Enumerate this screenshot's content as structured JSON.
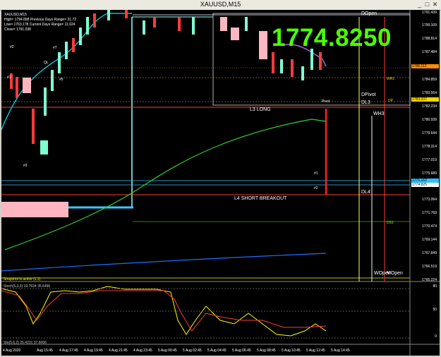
{
  "window": {
    "title": "XAUUSD,M15"
  },
  "info_panel": {
    "symbol": "XAUUSD,M15",
    "high": "High= 1794.898",
    "low": "Low= 1763.178",
    "close": "Close= 1791.038",
    "prev_range": "Previous Days Range= 31.72",
    "curr_range": "Current Days Range= 11.624"
  },
  "current_price_display": "1774.8250",
  "levels": {
    "dopen": "DOpen",
    "dpivot": "DPivot",
    "dl3": "DL3",
    "dp": "DP",
    "wh3": "WH3",
    "wr1": "WR1",
    "dl4": "DL4",
    "ds1": "DS1",
    "wopen": "WOpen",
    "mopen": "MOpen",
    "pivot": "Pivot",
    "l3_long": "L3 LONG",
    "l4_short": "L4 SHORT BREAKOUT",
    "s1": "#1",
    "s2": "#2",
    "s3": "#3",
    "s4": "#4",
    "s5": "#5",
    "s7": "#7",
    "ql": "QL",
    "one_marker": "1"
  },
  "snapshot_text": "Snapshot is active (1,1)",
  "indicator": {
    "stoch_label": "Stoch(5,3,3) 19.7634 35.6496",
    "stoch2_label": "Sto(5,6,2) 25.4231 37.6006",
    "levels": [
      "80",
      "50",
      "0"
    ]
  },
  "price_axis": [
    "1791.439",
    "1790.109",
    "1788.814",
    "1787.484",
    "1786.112",
    "1784.859",
    "1783.564",
    "1782.234",
    "1780.939",
    "1779.644",
    "1778.314",
    "1777.019",
    "1775.689",
    "1774.394",
    "1773.064",
    "1771.769",
    "1770.474",
    "1769.144",
    "1767.849",
    "1766.519",
    "1765.224"
  ],
  "price_tags": {
    "top": "1786.112",
    "mid": "1783.037",
    "b1": "1775.162",
    "b2": "1774.825"
  },
  "time_axis": [
    "4 Aug 2020",
    "Aug 15:45",
    "4 Aug 17:45",
    "4 Aug 19:45",
    "4 Aug 21:45",
    "4 Aug 23:45",
    "5 Aug 00:45",
    "5 Aug 02:45",
    "5 Aug 04:45",
    "5 Aug 06:45",
    "5 Aug 08:45",
    "5 Aug 10:45",
    "5 Aug 12:45",
    "5 Aug 14:45"
  ],
  "colors": {
    "bg": "#000000",
    "bull": "#7fffd4",
    "bear": "#ff3b3b",
    "ma_green": "#32cd32",
    "ma_blue": "#1e6fff",
    "cyan": "#00bfff",
    "yellow": "#ffff00",
    "big_price": "#4cff00"
  }
}
